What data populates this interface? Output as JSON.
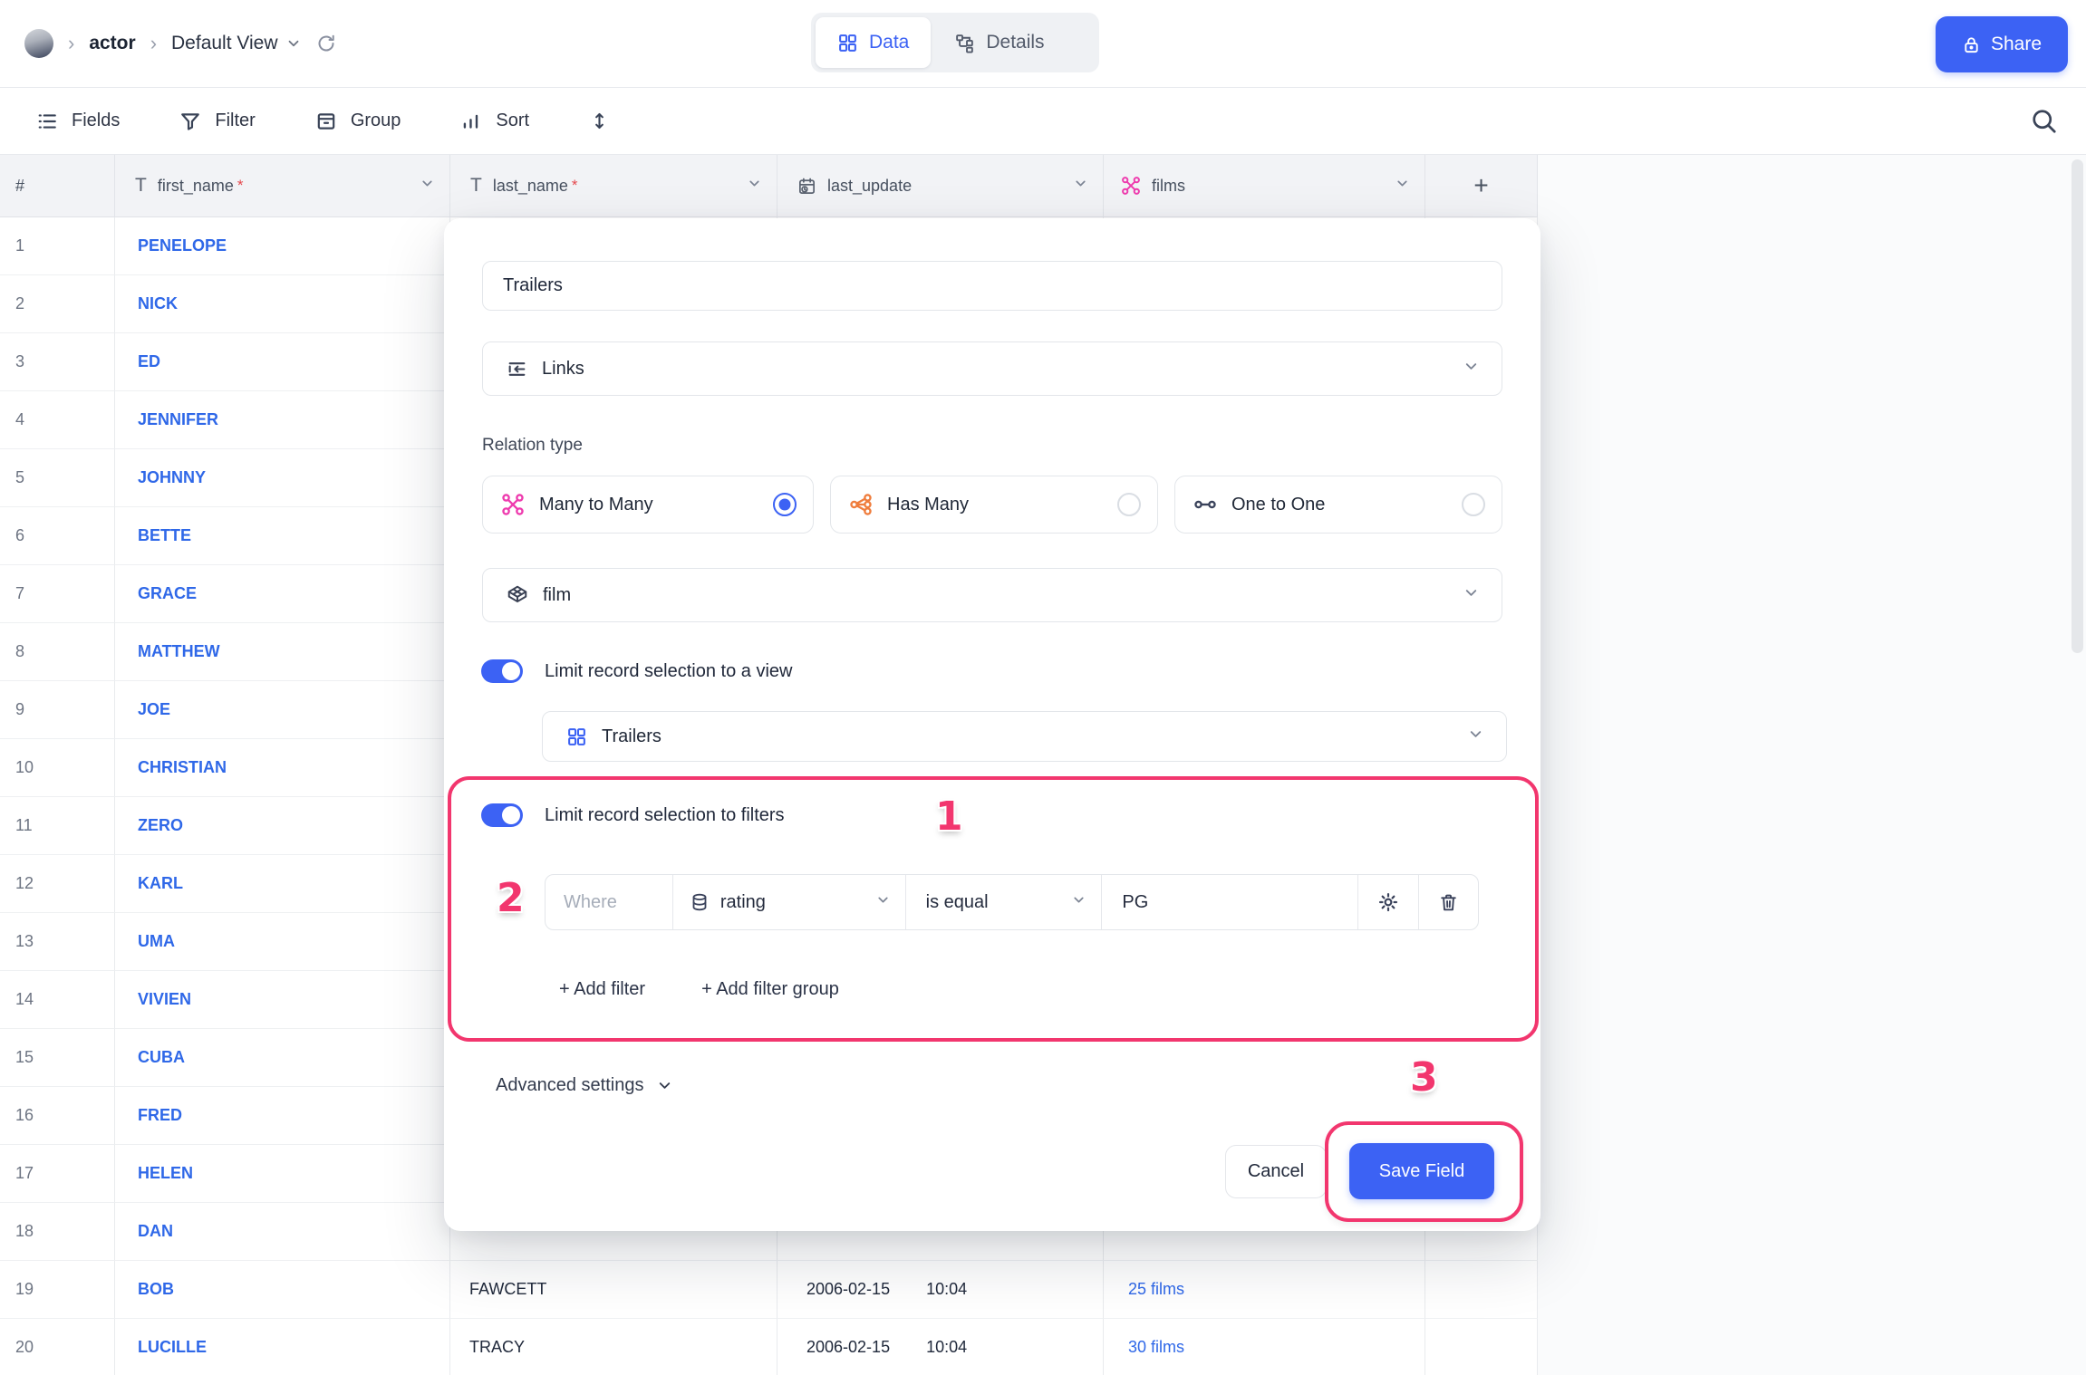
{
  "colors": {
    "accent": "#3C62F4",
    "link": "#2F68E8",
    "many_to_many_pink": "#EE3BAE",
    "has_many_orange": "#EF7D3D",
    "annotation_pink": "#F2366E"
  },
  "topbar": {
    "breadcrumb": {
      "table": "actor",
      "view": "Default View"
    },
    "tabs": [
      {
        "label": "Data",
        "active": true
      },
      {
        "label": "Details",
        "active": false
      }
    ],
    "share_label": "Share"
  },
  "toolbar": {
    "items": [
      "Fields",
      "Filter",
      "Group",
      "Sort"
    ]
  },
  "table": {
    "required_mark": "*",
    "add_column_label": "+",
    "columns": [
      {
        "label": "#"
      },
      {
        "label": "first_name",
        "required": true,
        "type": "text"
      },
      {
        "label": "last_name",
        "required": true,
        "type": "text"
      },
      {
        "label": "last_update",
        "type": "date"
      },
      {
        "label": "films",
        "type": "many-to-many-link"
      }
    ],
    "rows": [
      {
        "num": "1",
        "first_name": "PENELOPE",
        "last_name": "",
        "date": "",
        "time": "",
        "films": ""
      },
      {
        "num": "2",
        "first_name": "NICK",
        "last_name": "",
        "date": "",
        "time": "",
        "films": ""
      },
      {
        "num": "3",
        "first_name": "ED",
        "last_name": "",
        "date": "",
        "time": "",
        "films": ""
      },
      {
        "num": "4",
        "first_name": "JENNIFER",
        "last_name": "",
        "date": "",
        "time": "",
        "films": ""
      },
      {
        "num": "5",
        "first_name": "JOHNNY",
        "last_name": "",
        "date": "",
        "time": "",
        "films": ""
      },
      {
        "num": "6",
        "first_name": "BETTE",
        "last_name": "",
        "date": "",
        "time": "",
        "films": ""
      },
      {
        "num": "7",
        "first_name": "GRACE",
        "last_name": "",
        "date": "",
        "time": "",
        "films": ""
      },
      {
        "num": "8",
        "first_name": "MATTHEW",
        "last_name": "",
        "date": "",
        "time": "",
        "films": ""
      },
      {
        "num": "9",
        "first_name": "JOE",
        "last_name": "",
        "date": "",
        "time": "",
        "films": ""
      },
      {
        "num": "10",
        "first_name": "CHRISTIAN",
        "last_name": "",
        "date": "",
        "time": "",
        "films": ""
      },
      {
        "num": "11",
        "first_name": "ZERO",
        "last_name": "",
        "date": "",
        "time": "",
        "films": ""
      },
      {
        "num": "12",
        "first_name": "KARL",
        "last_name": "",
        "date": "",
        "time": "",
        "films": ""
      },
      {
        "num": "13",
        "first_name": "UMA",
        "last_name": "",
        "date": "",
        "time": "",
        "films": ""
      },
      {
        "num": "14",
        "first_name": "VIVIEN",
        "last_name": "",
        "date": "",
        "time": "",
        "films": ""
      },
      {
        "num": "15",
        "first_name": "CUBA",
        "last_name": "",
        "date": "",
        "time": "",
        "films": ""
      },
      {
        "num": "16",
        "first_name": "FRED",
        "last_name": "",
        "date": "",
        "time": "",
        "films": ""
      },
      {
        "num": "17",
        "first_name": "HELEN",
        "last_name": "",
        "date": "",
        "time": "",
        "films": ""
      },
      {
        "num": "18",
        "first_name": "DAN",
        "last_name": "",
        "date": "",
        "time": "",
        "films": ""
      },
      {
        "num": "19",
        "first_name": "BOB",
        "last_name": "FAWCETT",
        "date": "2006-02-15",
        "time": "10:04",
        "films": "25 films"
      },
      {
        "num": "20",
        "first_name": "LUCILLE",
        "last_name": "TRACY",
        "date": "2006-02-15",
        "time": "10:04",
        "films": "30 films"
      }
    ]
  },
  "modal": {
    "name_value": "Trailers",
    "type_value": "Links",
    "relation_label": "Relation type",
    "relations": [
      {
        "label": "Many to Many",
        "selected": true
      },
      {
        "label": "Has Many",
        "selected": false
      },
      {
        "label": "One to One",
        "selected": false
      }
    ],
    "table_value": "film",
    "limit_view_label": "Limit record selection to a view",
    "view_value": "Trailers",
    "limit_filter_label": "Limit record selection to filters",
    "filter": {
      "where": "Where",
      "field": "rating",
      "operator": "is equal",
      "value": "PG"
    },
    "add_filter": "+ Add filter",
    "add_filter_group": "+ Add filter group",
    "advanced_label": "Advanced settings",
    "cancel_label": "Cancel",
    "save_label": "Save Field"
  },
  "annotations": {
    "one": "1",
    "two": "2",
    "three": "3"
  }
}
